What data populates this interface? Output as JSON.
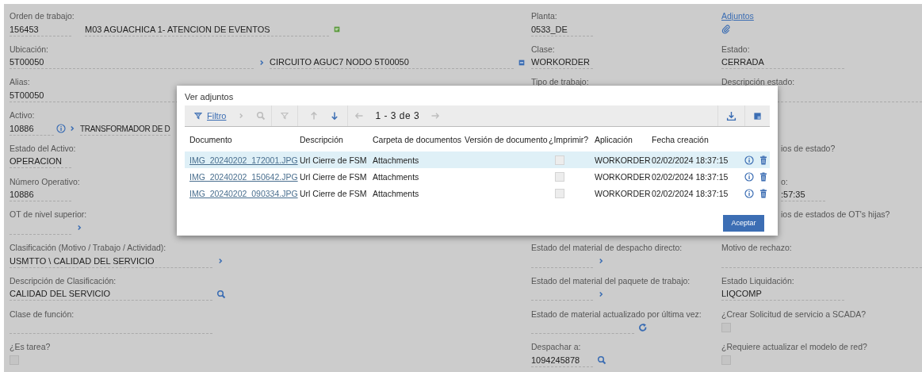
{
  "form": {
    "columns": [
      [
        {
          "label": "Orden de trabajo:",
          "parts": [
            {
              "kind": "value",
              "text": "156453"
            },
            {
              "kind": "desc",
              "text": "M03 AGUACHICA 1- ATENCION DE EVENTOS"
            },
            {
              "kind": "note"
            }
          ]
        },
        {
          "label": "Ubicación:",
          "parts": [
            {
              "kind": "value",
              "text": "5T00050"
            },
            {
              "kind": "chevron"
            },
            {
              "kind": "desc",
              "text": "CIRCUITO AGUC7 NODO 5T00050"
            },
            {
              "kind": "detail"
            }
          ]
        },
        {
          "label": "Alias:",
          "parts": [
            {
              "kind": "value",
              "text": "5T00050"
            }
          ]
        },
        {
          "label": "Activo:",
          "parts": [
            {
              "kind": "value",
              "text": "10886"
            },
            {
              "kind": "info"
            },
            {
              "kind": "chevron"
            },
            {
              "kind": "desc",
              "text": "TRANSFORMADOR DE D"
            }
          ]
        },
        {
          "label": "Estado del Activo:",
          "parts": [
            {
              "kind": "value",
              "text": "OPERACION"
            }
          ]
        },
        {
          "label": "Número Operativo:",
          "parts": [
            {
              "kind": "value",
              "text": "10886"
            }
          ]
        },
        {
          "label": "OT de nivel superior:",
          "parts": [
            {
              "kind": "value"
            },
            {
              "kind": "chevron"
            }
          ]
        },
        {
          "label": "Clasificación (Motivo / Trabajo / Actividad):",
          "parts": [
            {
              "kind": "value",
              "text": "USMTTO \\ CALIDAD DEL SERVICIO"
            },
            {
              "kind": "chevron"
            }
          ]
        },
        {
          "label": "Descripción de Clasificación:",
          "parts": [
            {
              "kind": "value",
              "text": "CALIDAD DEL SERVICIO"
            },
            {
              "kind": "search"
            }
          ]
        },
        {
          "label": "Clase de función:",
          "parts": [
            {
              "kind": "value"
            }
          ]
        },
        {
          "label": "¿Es tarea?",
          "parts": [
            {
              "kind": "checkbox",
              "checked": false
            }
          ]
        }
      ],
      [
        {
          "label": "Planta:",
          "parts": [
            {
              "kind": "value",
              "text": "0533_DE"
            }
          ]
        },
        {
          "label": "Clase:",
          "parts": [
            {
              "kind": "value",
              "text": "WORKORDER"
            }
          ]
        },
        {
          "label": "Tipo de trabajo:"
        },
        {},
        {},
        {},
        {},
        {
          "label": "Estado del material de despacho directo:",
          "parts": [
            {
              "kind": "value"
            },
            {
              "kind": "chevron"
            }
          ]
        },
        {
          "label": "Estado del material del paquete de trabajo:",
          "parts": [
            {
              "kind": "value"
            },
            {
              "kind": "chevron"
            }
          ]
        },
        {
          "label": "Estado de material actualizado por última vez:",
          "parts": [
            {
              "kind": "value"
            },
            {
              "kind": "refresh"
            }
          ]
        },
        {
          "label": "Despachar a:",
          "parts": [
            {
              "kind": "value",
              "text": "1094245878"
            },
            {
              "kind": "search"
            }
          ]
        }
      ],
      [
        {
          "label": "Adjuntos",
          "link": true,
          "parts": [
            {
              "kind": "clip"
            }
          ]
        },
        {
          "label": "Estado:",
          "parts": [
            {
              "kind": "value",
              "text": "CERRADA"
            }
          ]
        },
        {
          "label": "Descripción estado:",
          "parts": [
            {
              "kind": "value"
            }
          ]
        },
        {},
        {
          "covered": true,
          "label": "ios de estado?"
        },
        {
          "covered": true,
          "label": "o:",
          "parts": [
            {
              "kind": "value",
              "text": ":57:35"
            }
          ]
        },
        {
          "covered": true,
          "label": "ios de estados de OT's hijas?"
        },
        {
          "label": "Motivo de rechazo:",
          "parts": [
            {
              "kind": "value"
            }
          ]
        },
        {
          "label": "Estado Liquidación:",
          "parts": [
            {
              "kind": "value",
              "text": "LIQCOMP"
            }
          ]
        },
        {
          "label": "¿Crear Solicitud de servicio a SCADA?",
          "parts": [
            {
              "kind": "checkbox",
              "checked": false
            }
          ]
        },
        {
          "label": "¿Requiere actualizar el modelo de red?",
          "parts": [
            {
              "kind": "checkbox",
              "checked": false
            }
          ]
        }
      ]
    ]
  },
  "dialog": {
    "title": "Ver adjuntos",
    "toolbar": {
      "tools": [
        {
          "kind": "filter",
          "label": "Filtro",
          "disabled": false
        },
        {
          "kind": "chevron",
          "disabled": true
        },
        {
          "kind": "search",
          "disabled": true
        },
        {
          "kind": "clear_filter",
          "disabled": true
        },
        {
          "kind": "up",
          "disabled": true
        },
        {
          "kind": "down",
          "disabled": false
        },
        {
          "kind": "prev",
          "disabled": true
        },
        {
          "kind": "pager",
          "label": "1 - 3 de 3"
        },
        {
          "kind": "next",
          "disabled": true
        }
      ],
      "right_tools": [
        {
          "kind": "download",
          "disabled": false
        },
        {
          "kind": "maximize",
          "disabled": false
        }
      ]
    },
    "table": {
      "columns": [
        "Documento",
        "Descripción",
        "Carpeta de documentos",
        "Versión de documento",
        "¿Imprimir?",
        "Aplicación",
        "Fecha creación"
      ],
      "rows": [
        {
          "document": "IMG_20240202_172001.JPG",
          "description": "Url Cierre de FSM",
          "folder": "Attachments",
          "print": false,
          "application": "WORKORDER",
          "created": "02/02/2024 18:37:15",
          "selected": true
        },
        {
          "document": "IMG_20240202_150642.JPG",
          "description": "Url Cierre de FSM",
          "folder": "Attachments",
          "print": false,
          "application": "WORKORDER",
          "created": "02/02/2024 18:37:15",
          "selected": false
        },
        {
          "document": "IMG_20240202_090334.JPG",
          "description": "Url Cierre de FSM",
          "folder": "Attachments",
          "print": false,
          "application": "WORKORDER",
          "created": "02/02/2024 18:37:15",
          "selected": false
        }
      ]
    },
    "buttons": [
      "Aceptar"
    ]
  }
}
